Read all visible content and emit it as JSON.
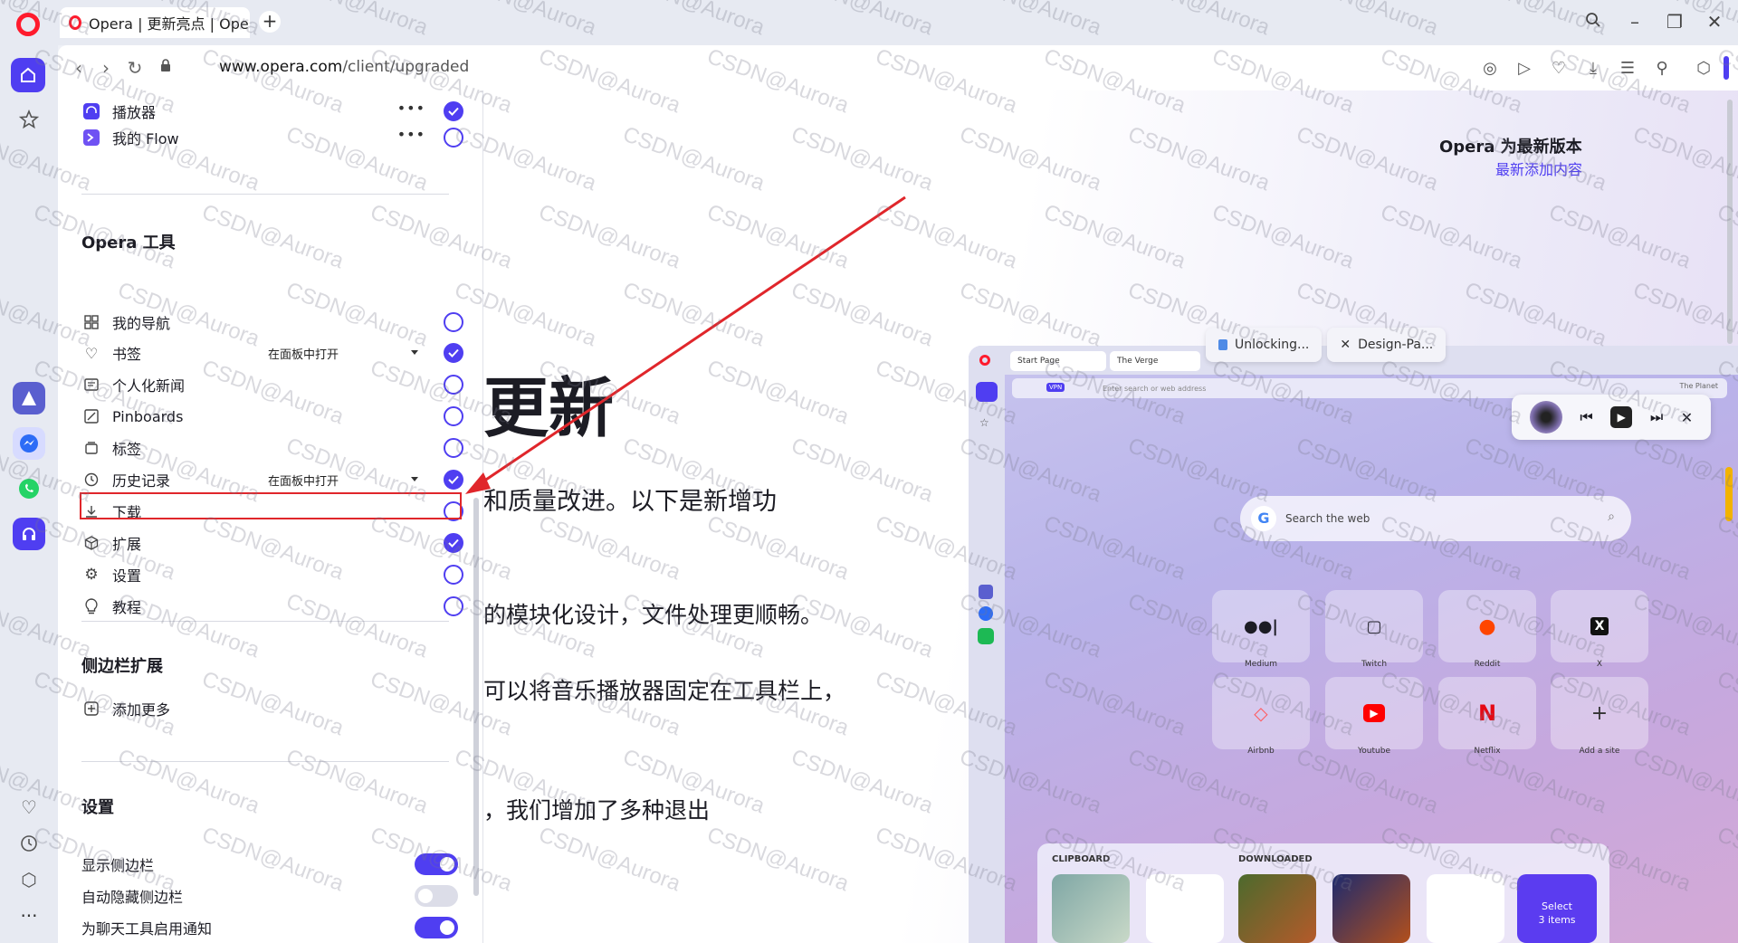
{
  "browser": {
    "tab_title": "Opera | 更新亮点 | Opera",
    "url_domain": "www.opera.com",
    "url_path": "/client/upgraded"
  },
  "panel": {
    "top_items": [
      {
        "label": "播放器",
        "checked": true,
        "icon": "player-icon"
      },
      {
        "label": "我的 Flow",
        "checked": false,
        "icon": "flow-icon"
      }
    ],
    "tools_heading": "Opera 工具",
    "tools": [
      {
        "label": "我的导航",
        "checked": false,
        "icon": "grid-icon",
        "select": ""
      },
      {
        "label": "书签",
        "checked": true,
        "icon": "heart-icon",
        "select": "在面板中打开"
      },
      {
        "label": "个人化新闻",
        "checked": false,
        "icon": "news-icon",
        "select": ""
      },
      {
        "label": "Pinboards",
        "checked": false,
        "icon": "pinboard-icon",
        "select": ""
      },
      {
        "label": "标签",
        "checked": false,
        "icon": "tabs-icon",
        "select": ""
      },
      {
        "label": "历史记录",
        "checked": true,
        "icon": "clock-icon",
        "select": "在面板中打开"
      },
      {
        "label": "下载",
        "checked": false,
        "icon": "download-icon",
        "select": ""
      },
      {
        "label": "扩展",
        "checked": true,
        "icon": "cube-icon",
        "select": ""
      },
      {
        "label": "设置",
        "checked": false,
        "icon": "gear-icon",
        "select": ""
      },
      {
        "label": "教程",
        "checked": false,
        "icon": "bulb-icon",
        "select": ""
      }
    ],
    "ext_heading": "侧边栏扩展",
    "add_more": "添加更多",
    "settings_heading": "设置",
    "settings": [
      {
        "label": "显示侧边栏",
        "on": true
      },
      {
        "label": "自动隐藏侧边栏",
        "on": false
      },
      {
        "label": "为聊天工具启用通知",
        "on": true
      }
    ]
  },
  "page": {
    "heading": "更新",
    "lines": [
      "和质量改进。以下是新增功",
      "的模块化设计，文件处理更顺畅。",
      "可以将音乐播放器固定在工具栏上，",
      "，我们增加了多种退出"
    ],
    "version_title": "Opera 为最新版本",
    "version_link": "最新添加内容"
  },
  "preview": {
    "tab1": "Start Page",
    "tab2": "The Verge",
    "float_tab1": "Unlocking...",
    "float_tab2": "Design-Pa...",
    "address_placeholder": "Enter search or web address",
    "vpn": "VPN",
    "corner_label": "The Planet",
    "search_placeholder": "Search the web",
    "speed_dials": [
      {
        "label": "Medium",
        "glyph": "●●|"
      },
      {
        "label": "Twitch",
        "glyph": "▢"
      },
      {
        "label": "Reddit",
        "glyph": "●"
      },
      {
        "label": "X",
        "glyph": "X"
      },
      {
        "label": "Airbnb",
        "glyph": "◇"
      },
      {
        "label": "Youtube",
        "glyph": "▶"
      },
      {
        "label": "Netflix",
        "glyph": "N"
      },
      {
        "label": "Add a site",
        "glyph": "+"
      }
    ],
    "clipboard": "CLIPBOARD",
    "downloaded": "DOWNLOADED",
    "select_line1": "Select",
    "select_line2": "3 items"
  },
  "watermark": "CSDN@Aurora",
  "colors": {
    "accent": "#4f3ef1",
    "highlight": "#e0262b",
    "opera_red": "#ff1b2d"
  }
}
